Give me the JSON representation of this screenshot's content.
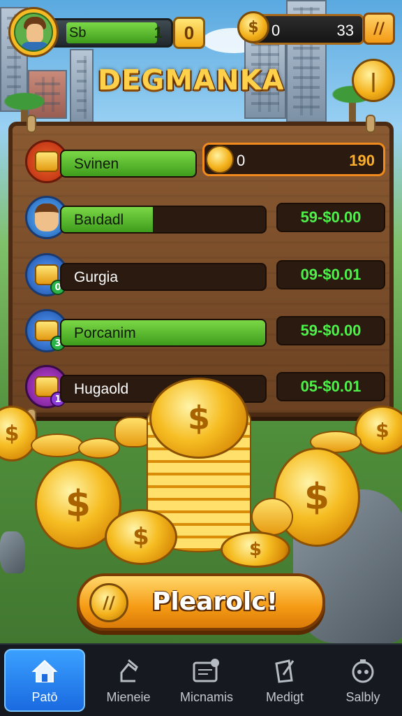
{
  "hud": {
    "player_name": "Sb",
    "player_level": "1",
    "level_badge": "0",
    "coins_left": "0",
    "coins_right": "33",
    "pause_label": "//"
  },
  "title": "DEGMANKA",
  "side_coin_symbol": "|",
  "leaderboard": {
    "header": {
      "label": "Svinen",
      "coin_left": "0",
      "coin_right": "190"
    },
    "rows": [
      {
        "label": "Baıdadl",
        "value": "59-$0.00",
        "fill": 0.45,
        "icon": "player-avatar"
      },
      {
        "label": "Gurgia",
        "value": "09-$0.01",
        "fill": 0,
        "icon": "coin-stack",
        "badge": "0"
      },
      {
        "label": "Porcanim",
        "value": "59-$0.00",
        "fill": 1,
        "icon": "coin-stack",
        "badge": "3"
      },
      {
        "label": "Hugaold",
        "value": "05-$0.01",
        "fill": 0,
        "icon": "coin-stack",
        "badge": "1"
      }
    ]
  },
  "play_button": {
    "label": "Plearolc!",
    "coin_symbol": "//"
  },
  "nav": {
    "items": [
      {
        "label": "Patō",
        "icon": "home-icon",
        "active": true
      },
      {
        "label": "Mieneie",
        "icon": "profile-icon",
        "active": false
      },
      {
        "label": "Micnamis",
        "icon": "video-icon",
        "active": false
      },
      {
        "label": "Medigt",
        "icon": "edit-icon",
        "active": false
      },
      {
        "label": "Salbly",
        "icon": "shield-icon",
        "active": false
      }
    ]
  },
  "colors": {
    "accent_gold": "#f4b11a",
    "progress_green": "#3e9c1c",
    "value_green": "#4ff04a",
    "nav_active": "#1a6ae0",
    "panel_wood": "#6b4222"
  }
}
